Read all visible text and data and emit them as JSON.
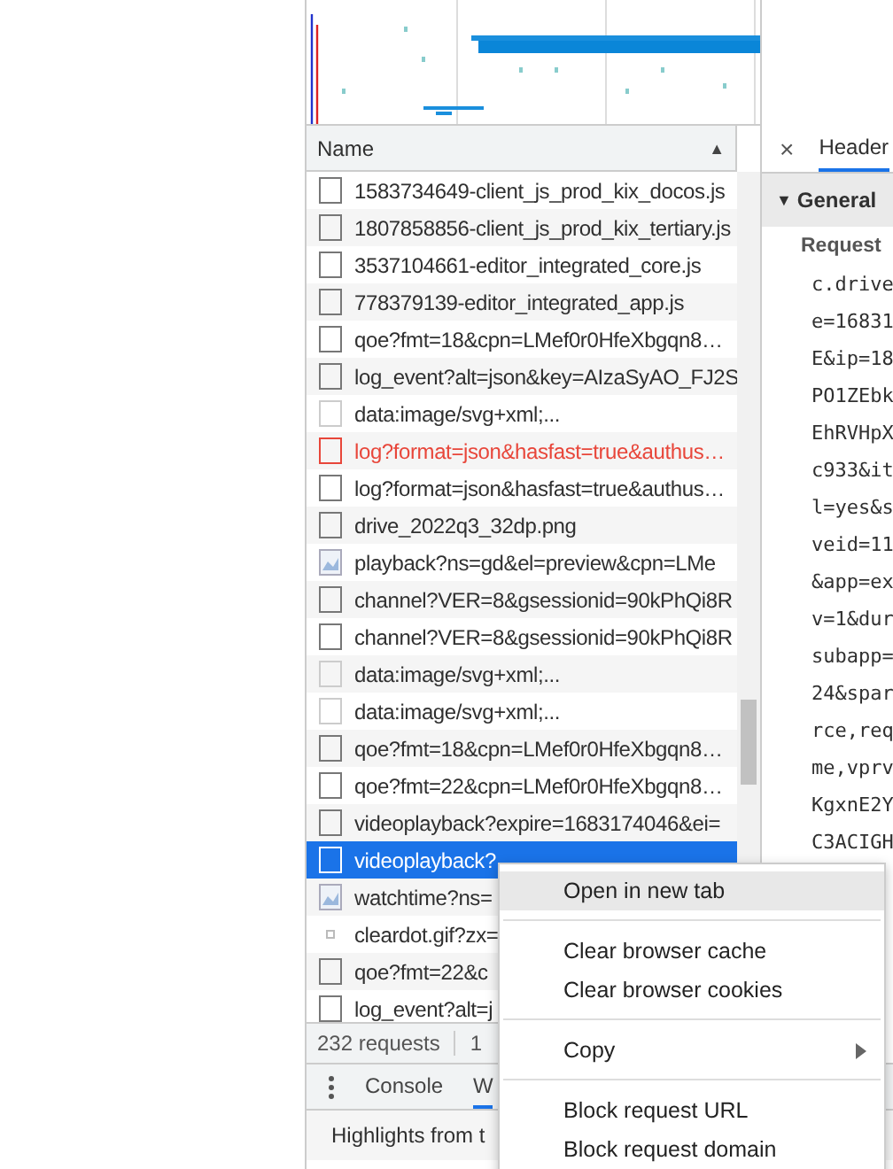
{
  "requests": {
    "column": "Name",
    "sort_indicator": "▲",
    "rows": [
      {
        "name": "1583734649-client_js_prod_kix_docos.js",
        "kind": "doc",
        "error": false,
        "selected": false
      },
      {
        "name": "1807858856-client_js_prod_kix_tertiary.js",
        "kind": "doc",
        "error": false,
        "selected": false
      },
      {
        "name": "3537104661-editor_integrated_core.js",
        "kind": "doc",
        "error": false,
        "selected": false
      },
      {
        "name": "778379139-editor_integrated_app.js",
        "kind": "doc",
        "error": false,
        "selected": false
      },
      {
        "name": "qoe?fmt=18&cpn=LMef0r0HfeXbgqn8…",
        "kind": "doc",
        "error": false,
        "selected": false
      },
      {
        "name": "log_event?alt=json&key=AIzaSyAO_FJ2S",
        "kind": "doc",
        "error": false,
        "selected": false
      },
      {
        "name": "data:image/svg+xml;...",
        "kind": "data",
        "error": false,
        "selected": false
      },
      {
        "name": "log?format=json&hasfast=true&authus…",
        "kind": "doc",
        "error": true,
        "selected": false
      },
      {
        "name": "log?format=json&hasfast=true&authus…",
        "kind": "doc",
        "error": false,
        "selected": false
      },
      {
        "name": "drive_2022q3_32dp.png",
        "kind": "doc",
        "error": false,
        "selected": false
      },
      {
        "name": "playback?ns=gd&el=preview&cpn=LMe",
        "kind": "image",
        "error": false,
        "selected": false
      },
      {
        "name": "channel?VER=8&gsessionid=90kPhQi8R",
        "kind": "doc",
        "error": false,
        "selected": false
      },
      {
        "name": "channel?VER=8&gsessionid=90kPhQi8R",
        "kind": "doc",
        "error": false,
        "selected": false
      },
      {
        "name": "data:image/svg+xml;...",
        "kind": "data",
        "error": false,
        "selected": false
      },
      {
        "name": "data:image/svg+xml;...",
        "kind": "data",
        "error": false,
        "selected": false
      },
      {
        "name": "qoe?fmt=18&cpn=LMef0r0HfeXbgqn8…",
        "kind": "doc",
        "error": false,
        "selected": false
      },
      {
        "name": "qoe?fmt=22&cpn=LMef0r0HfeXbgqn8…",
        "kind": "doc",
        "error": false,
        "selected": false
      },
      {
        "name": "videoplayback?expire=1683174046&ei=",
        "kind": "doc",
        "error": false,
        "selected": false
      },
      {
        "name": "videoplayback?",
        "kind": "doc",
        "error": false,
        "selected": true
      },
      {
        "name": "watchtime?ns=",
        "kind": "image",
        "error": false,
        "selected": false
      },
      {
        "name": "cleardot.gif?zx=",
        "kind": "dot",
        "error": false,
        "selected": false
      },
      {
        "name": "qoe?fmt=22&c",
        "kind": "doc",
        "error": false,
        "selected": false
      },
      {
        "name": "log_event?alt=j",
        "kind": "doc",
        "error": false,
        "selected": false
      }
    ],
    "status": [
      "232 requests",
      "1"
    ]
  },
  "details": {
    "close": "×",
    "tabs": [
      {
        "label": "Header",
        "selected": true
      }
    ],
    "section": {
      "title": "General",
      "expanded": true,
      "toggle": "▼",
      "label": "Request",
      "lines": [
        "c.drive",
        "e=16831",
        "E&ip=18",
        "PO1ZEbk",
        "EhRVHpX",
        "c933&it",
        "l=yes&s",
        "veid=11",
        "&app=ex",
        "v=1&dur",
        "subapp=",
        "24&spar",
        "rce,req",
        "me,vprv",
        "KgxnE2Y",
        "C3ACIGH"
      ]
    }
  },
  "drawer": {
    "tabs": [
      {
        "label": "Console",
        "selected": false
      },
      {
        "label": "W",
        "selected": true
      }
    ],
    "message": "Highlights from t"
  },
  "context_menu": {
    "groups": [
      [
        {
          "label": "Open in new tab",
          "hovered": true,
          "submenu": false
        }
      ],
      [
        {
          "label": "Clear browser cache",
          "hovered": false,
          "submenu": false
        },
        {
          "label": "Clear browser cookies",
          "hovered": false,
          "submenu": false
        }
      ],
      [
        {
          "label": "Copy",
          "hovered": false,
          "submenu": true
        }
      ],
      [
        {
          "label": "Block request URL",
          "hovered": false,
          "submenu": false
        },
        {
          "label": "Block request domain",
          "hovered": false,
          "submenu": false
        }
      ]
    ]
  }
}
